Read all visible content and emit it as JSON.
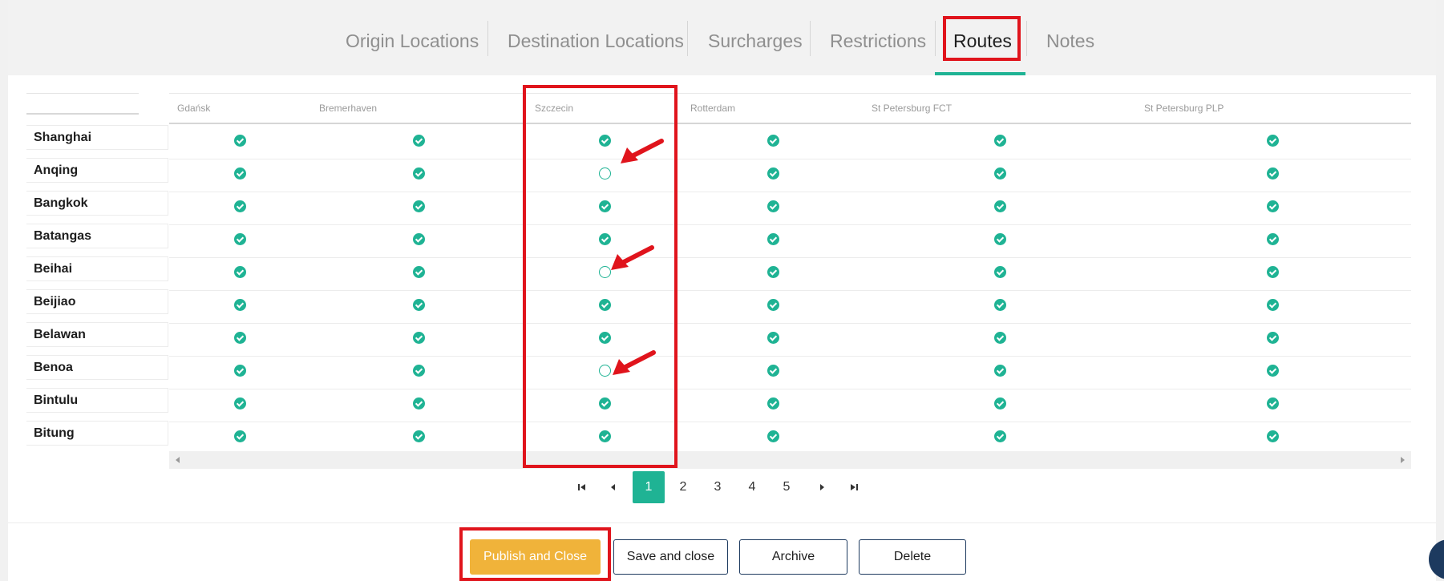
{
  "tabs": [
    {
      "label": "Origin Locations"
    },
    {
      "label": "Destination Locations"
    },
    {
      "label": "Surcharges"
    },
    {
      "label": "Restrictions"
    },
    {
      "label": "Routes"
    },
    {
      "label": "Notes"
    }
  ],
  "active_tab": "Routes",
  "table": {
    "columns": [
      "Gdańsk",
      "Bremerhaven",
      "Szczecin",
      "Rotterdam",
      "St Petersburg FCT",
      "St Petersburg PLP"
    ],
    "rows": [
      {
        "label": "Shanghai",
        "cells": [
          true,
          true,
          true,
          true,
          true,
          true
        ]
      },
      {
        "label": "Anqing",
        "cells": [
          true,
          true,
          false,
          true,
          true,
          true
        ]
      },
      {
        "label": "Bangkok",
        "cells": [
          true,
          true,
          true,
          true,
          true,
          true
        ]
      },
      {
        "label": "Batangas",
        "cells": [
          true,
          true,
          true,
          true,
          true,
          true
        ]
      },
      {
        "label": "Beihai",
        "cells": [
          true,
          true,
          false,
          true,
          true,
          true
        ]
      },
      {
        "label": "Beijiao",
        "cells": [
          true,
          true,
          true,
          true,
          true,
          true
        ]
      },
      {
        "label": "Belawan",
        "cells": [
          true,
          true,
          true,
          true,
          true,
          true
        ]
      },
      {
        "label": "Benoa",
        "cells": [
          true,
          true,
          false,
          true,
          true,
          true
        ]
      },
      {
        "label": "Bintulu",
        "cells": [
          true,
          true,
          true,
          true,
          true,
          true
        ]
      },
      {
        "label": "Bitung",
        "cells": [
          true,
          true,
          true,
          true,
          true,
          true
        ]
      }
    ]
  },
  "pagination": {
    "pages": [
      "1",
      "2",
      "3",
      "4",
      "5"
    ],
    "current": "1"
  },
  "actions": {
    "publish_label": "Publish and Close",
    "save_label": "Save and close",
    "archive_label": "Archive",
    "delete_label": "Delete"
  },
  "colors": {
    "accent": "#1fb394",
    "annotation_red": "#e0141c",
    "primary_button": "#f0b33a",
    "button_border": "#1d3a5f"
  }
}
